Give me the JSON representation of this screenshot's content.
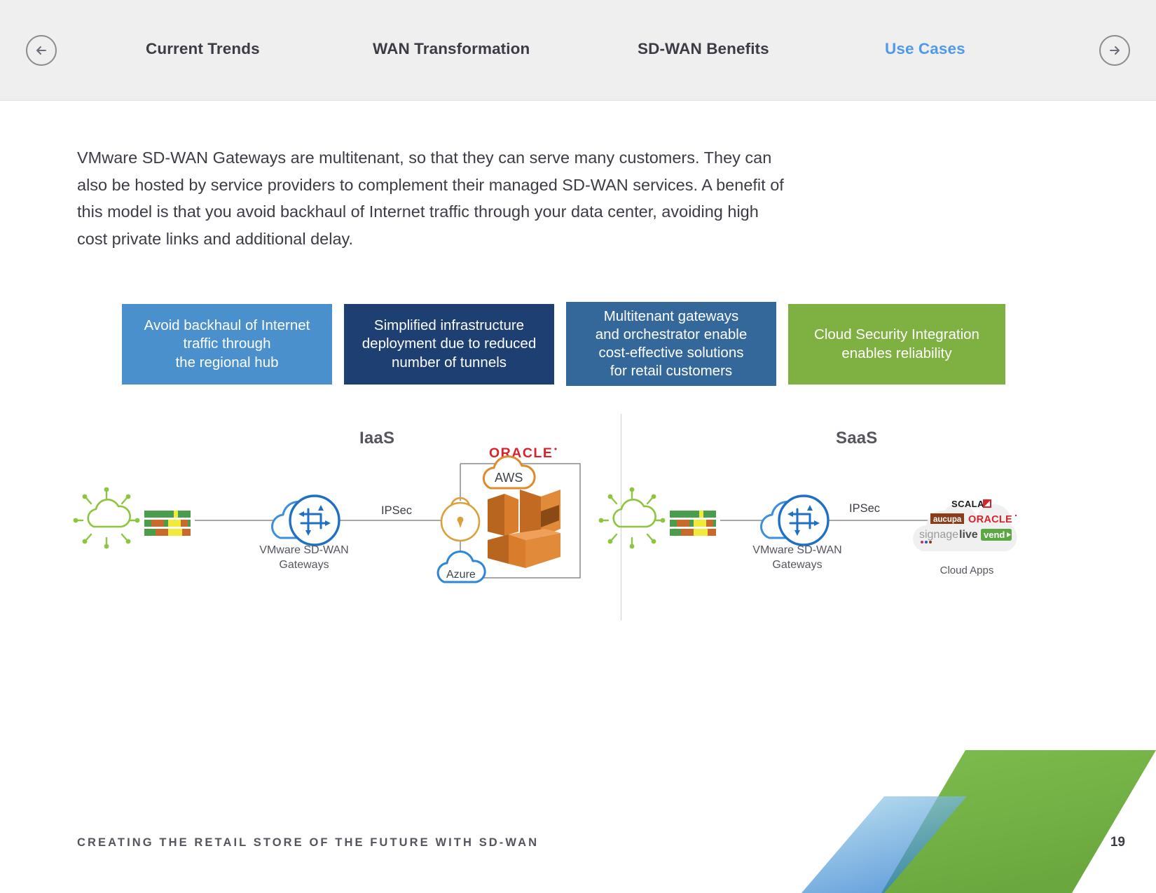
{
  "nav": {
    "back_icon": "arrow-left-circle-icon",
    "forward_icon": "arrow-right-circle-icon",
    "items": [
      {
        "label": "Current Trends",
        "active": false
      },
      {
        "label": "WAN Transformation",
        "active": false
      },
      {
        "label": "SD-WAN Benefits",
        "active": false
      },
      {
        "label": "Use Cases",
        "active": true
      }
    ],
    "active_color": "#4f9ae8",
    "inactive_color": "#3c3c46"
  },
  "intro": {
    "paragraph": "VMware SD-WAN Gateways are multitenant, so that they can serve many customers. They can also be hosted by service providers to complement their managed SD-WAN services. A benefit of this model is that you avoid backhaul of Internet traffic through your data center, avoiding high cost private links and additional delay."
  },
  "callouts": [
    {
      "text": "Avoid backhaul of Internet traffic through the regional hub",
      "lines": [
        "Avoid backhaul of Internet",
        "traffic through",
        "the regional hub"
      ],
      "color": "#4a90cc"
    },
    {
      "text": "Simplified infrastructure deployment due to reduced number of tunnels",
      "lines": [
        "Simplified infrastructure",
        "deployment due to reduced",
        "number of tunnels"
      ],
      "color": "#1d3f72"
    },
    {
      "text": "Multitenant gateways and orchestrator enable cost-effective solutions for retail customers",
      "lines": [
        "Multitenant gateways",
        "and orchestrator enable",
        "cost-effective solutions",
        "for retail customers"
      ],
      "color": "#35689a"
    },
    {
      "text": "Cloud Security Integration enables reliability",
      "lines": [
        "Cloud Security Integration",
        "enables reliability"
      ],
      "color": "#7fb142"
    }
  ],
  "diagram": {
    "iaas": {
      "title": "IaaS",
      "branch_icon": "retail-store-network-icon",
      "switch_icon": "network-switch-stack-icon",
      "gateway_label": "VMware SD-WAN\nGateways",
      "gateway_label_line1": "VMware SD-WAN",
      "gateway_label_line2": "Gateways",
      "gateway_icon": "sd-wan-gateway-cloud-icon",
      "link_label": "IPSec",
      "lock_icon": "padlock-icon",
      "providers": [
        {
          "name": "ORACLE",
          "icon": "oracle-logo",
          "color": "#c6162c"
        },
        {
          "name": "AWS",
          "icon": "aws-cloud-icon",
          "color": "#e08a2e"
        },
        {
          "name": "Azure",
          "icon": "azure-cloud-icon",
          "color": "#2f86d8"
        }
      ]
    },
    "saas": {
      "title": "SaaS",
      "branch_icon": "retail-store-network-icon",
      "switch_icon": "network-switch-stack-icon",
      "gateway_label_line1": "VMware SD-WAN",
      "gateway_label_line2": "Gateways",
      "gateway_icon": "sd-wan-gateway-cloud-icon",
      "link_label": "IPSec",
      "cloud_apps_label": "Cloud Apps",
      "app_logos": [
        {
          "name": "SCALA",
          "color": "#1a1a1a",
          "accent": "#d8232a"
        },
        {
          "name": "aucupa",
          "color": "#ffffff",
          "accent": "#8a3d18"
        },
        {
          "name": "ORACLE",
          "color": "#d8232a",
          "accent": "#d8232a"
        },
        {
          "name": "signagelive",
          "color": "#8e8e8e",
          "accent": "#4b4b4b"
        },
        {
          "name": "vend",
          "color": "#ffffff",
          "accent": "#5aa744"
        }
      ]
    }
  },
  "footer": {
    "title": "CREATING THE RETAIL STORE OF THE FUTURE WITH SD-WAN",
    "page_number": "19"
  }
}
